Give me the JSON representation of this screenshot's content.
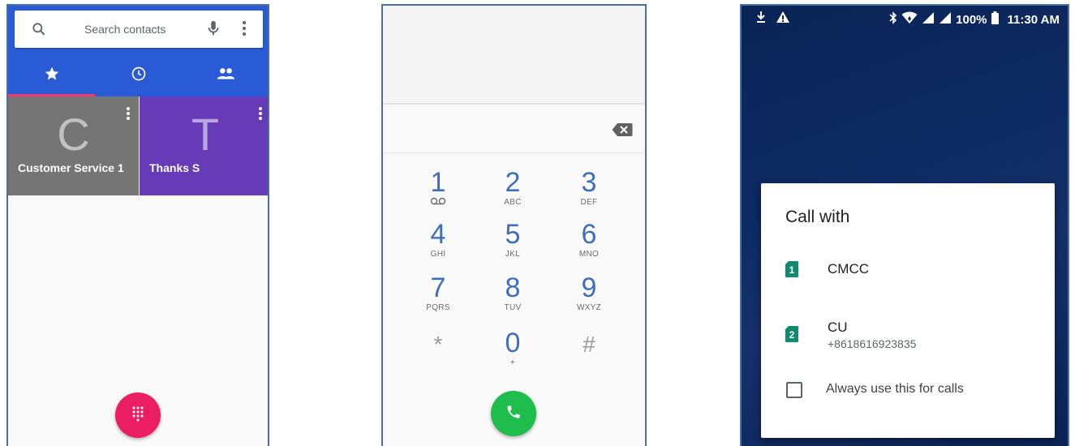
{
  "screen1": {
    "search": {
      "placeholder": "Search contacts"
    },
    "tabs": [
      {
        "icon": "star-icon"
      },
      {
        "icon": "clock-icon"
      },
      {
        "icon": "people-icon"
      }
    ],
    "favorites": [
      {
        "letter": "C",
        "name": "Customer Service 1",
        "color": "#757575"
      },
      {
        "letter": "T",
        "name": "Thanks S",
        "color": "#673ab7"
      }
    ],
    "colors": {
      "header": "#2a5bd7",
      "fab": "#ec1e63",
      "tab_indicator": "#f2386d"
    },
    "fab_icon": "dialpad-icon"
  },
  "screen2": {
    "keys": [
      {
        "digit": "1",
        "sub": ""
      },
      {
        "digit": "2",
        "sub": "ABC"
      },
      {
        "digit": "3",
        "sub": "DEF"
      },
      {
        "digit": "4",
        "sub": "GHI"
      },
      {
        "digit": "5",
        "sub": "JKL"
      },
      {
        "digit": "6",
        "sub": "MNO"
      },
      {
        "digit": "7",
        "sub": "PQRS"
      },
      {
        "digit": "8",
        "sub": "TUV"
      },
      {
        "digit": "9",
        "sub": "WXYZ"
      },
      {
        "digit": "*",
        "sub": ""
      },
      {
        "digit": "0",
        "sub": "+"
      },
      {
        "digit": "#",
        "sub": ""
      }
    ],
    "colors": {
      "digits": "#3f6fb8",
      "call_button": "#1fbd4c"
    },
    "icons": {
      "voicemail": "voicemail-icon",
      "backspace": "backspace-icon",
      "call": "phone-icon"
    }
  },
  "screen3": {
    "status": {
      "battery": "100%",
      "time": "11:30 AM"
    },
    "dialog": {
      "title": "Call with",
      "options": [
        {
          "slot": "1",
          "name": "CMCC",
          "number": ""
        },
        {
          "slot": "2",
          "name": "CU",
          "number": "+8618616923835"
        }
      ],
      "checkbox_label": "Always use this for calls",
      "checkbox_checked": false
    },
    "colors": {
      "sim": "#0f8a6e",
      "background": "#0b2457"
    }
  }
}
